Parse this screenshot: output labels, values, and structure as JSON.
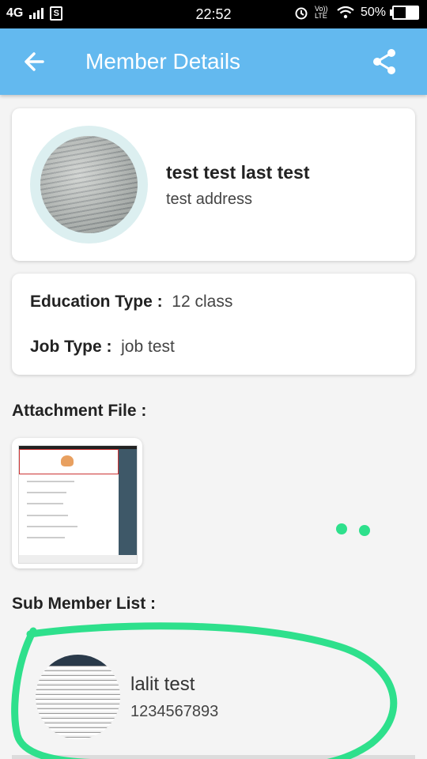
{
  "status_bar": {
    "network": "4G",
    "sim_label": "S",
    "time": "22:52",
    "volte_label": "Vo)) LTE",
    "battery": "50%"
  },
  "app_bar": {
    "title": "Member Details",
    "back_icon": "arrow-left-icon",
    "share_icon": "share-icon"
  },
  "profile": {
    "name": "test test last test",
    "address": "test address"
  },
  "info": {
    "education_label": "Education Type :",
    "education_value": "12 class",
    "job_label": "Job Type :",
    "job_value": "job test"
  },
  "attachment": {
    "label": "Attachment File :"
  },
  "sub_members": {
    "label": "Sub Member List :",
    "items": [
      {
        "name": "lalit test",
        "phone": "1234567893"
      }
    ]
  },
  "colors": {
    "app_bar": "#63b9ef",
    "highlight": "#2ee08c"
  }
}
